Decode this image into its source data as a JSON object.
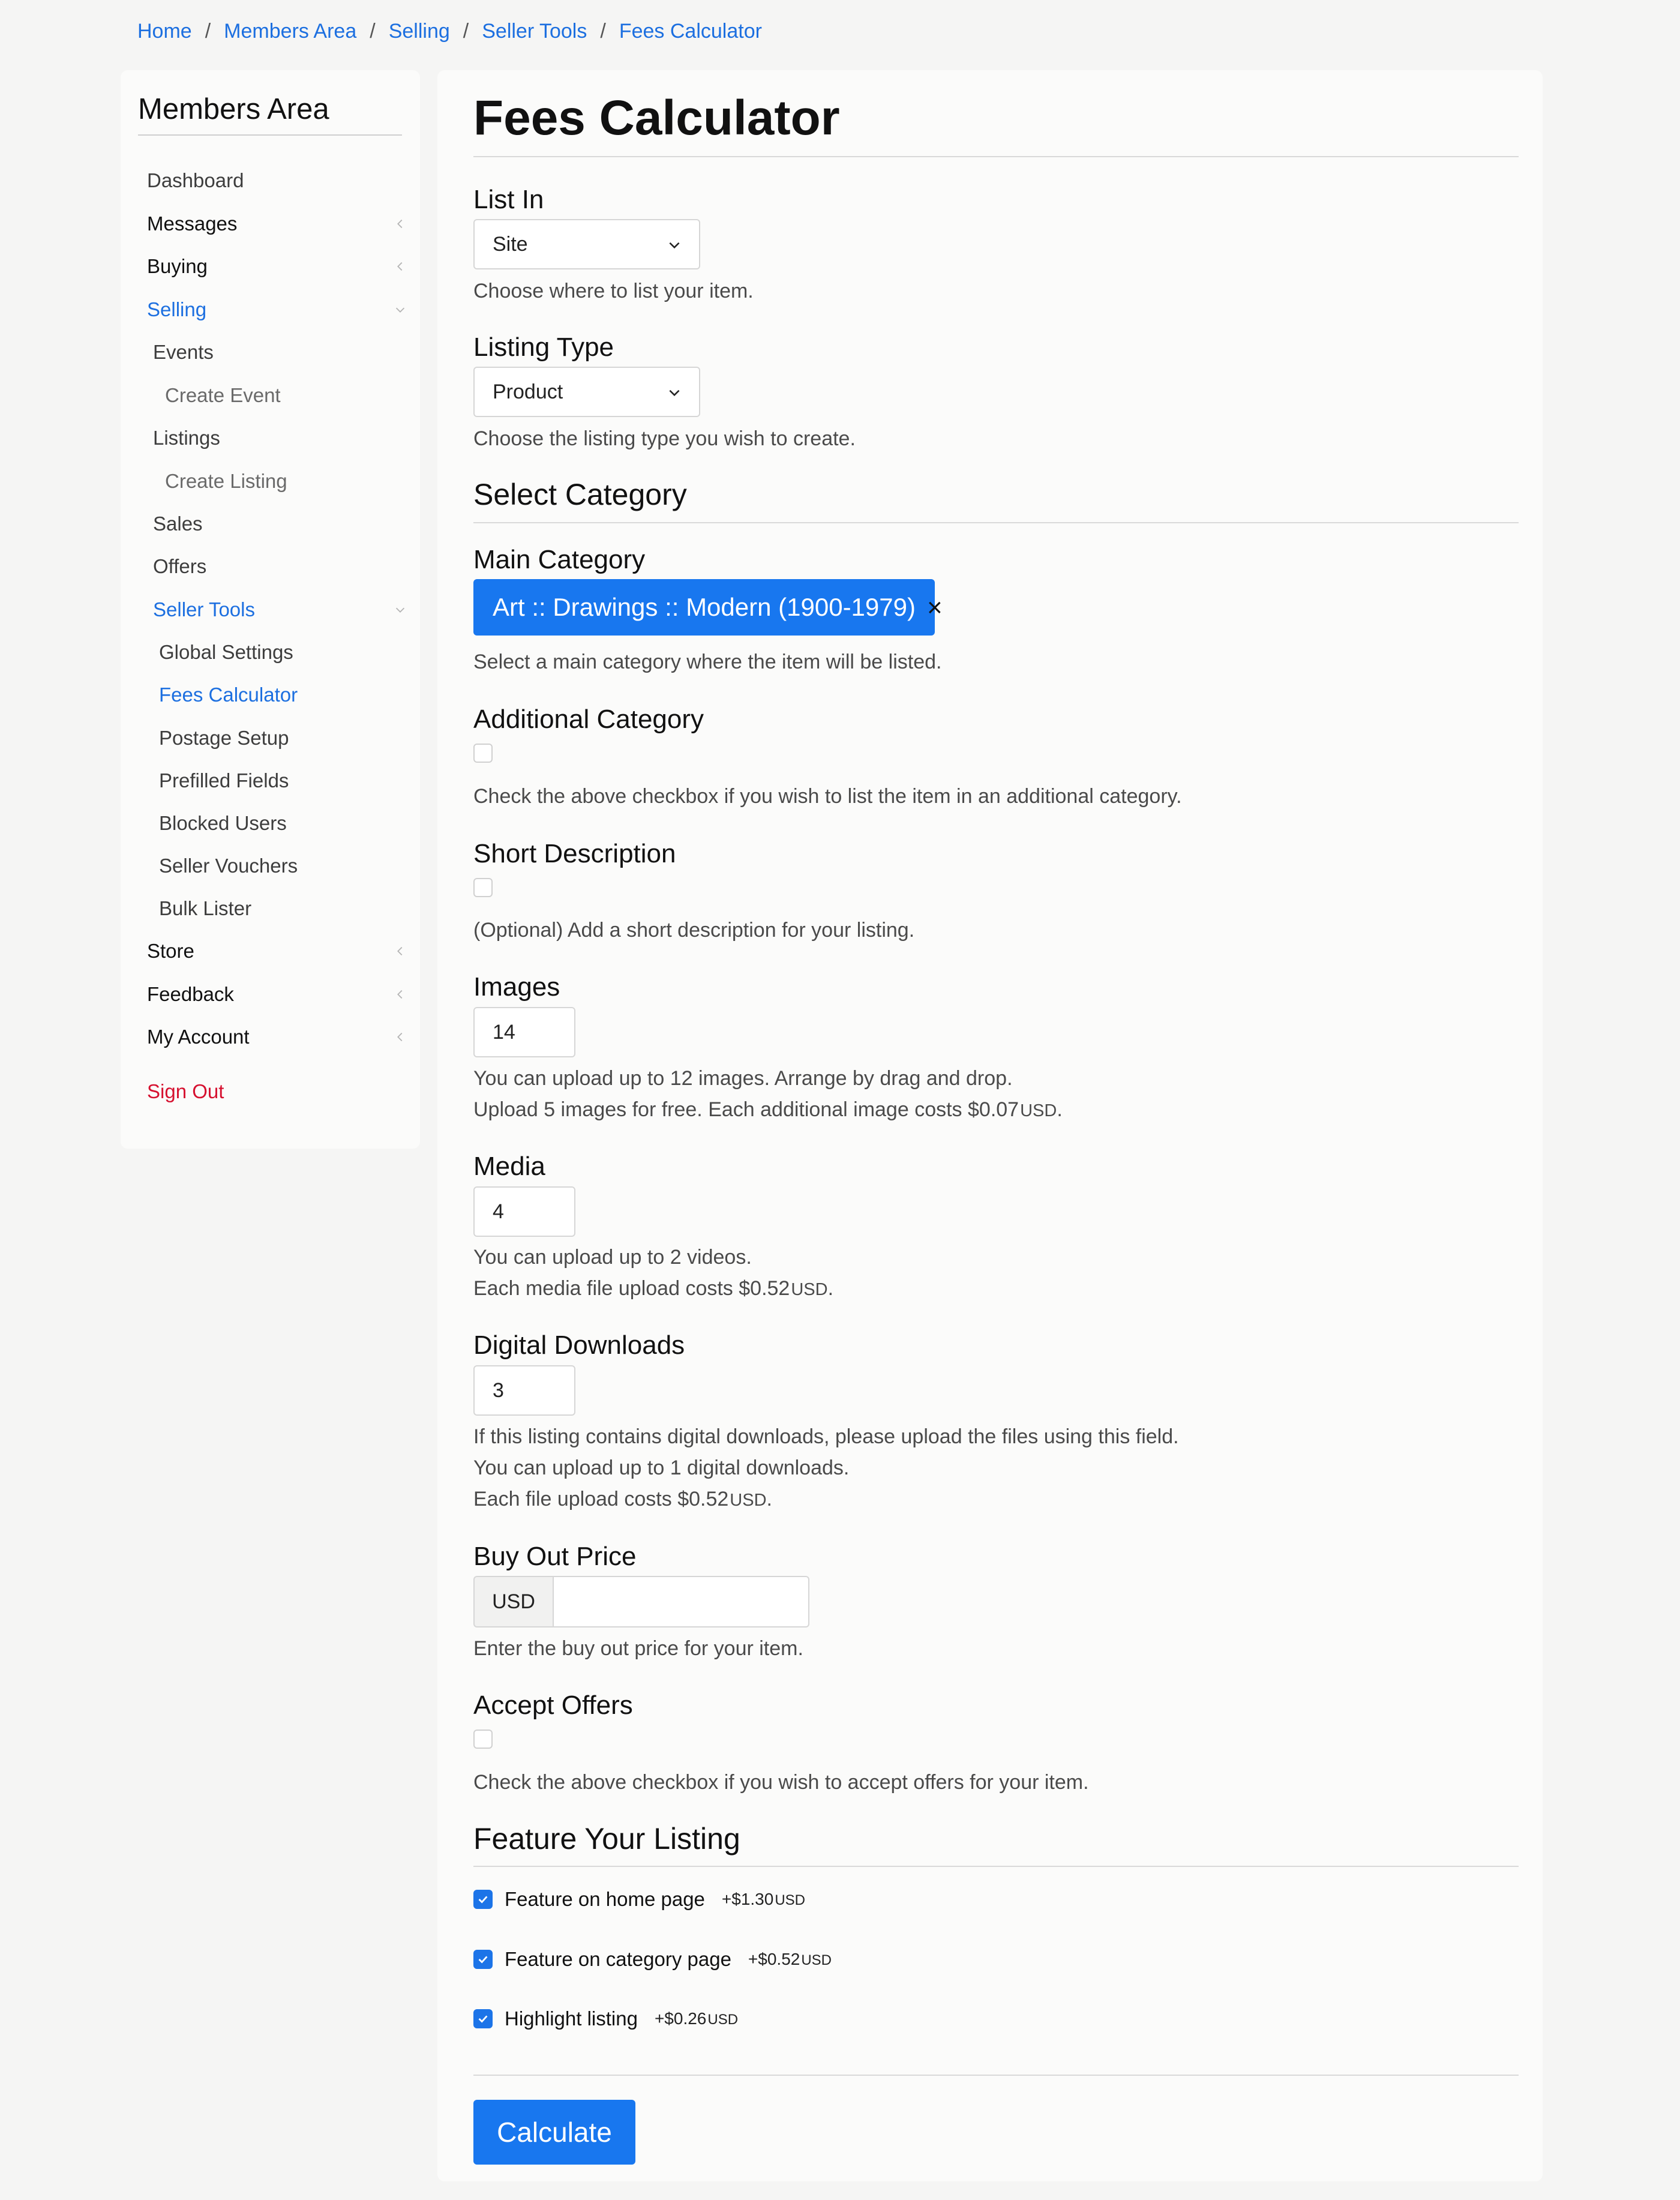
{
  "breadcrumb": [
    "Home",
    "Members Area",
    "Selling",
    "Seller Tools",
    "Fees Calculator"
  ],
  "breadcrumb_sep": "/",
  "sidebar": {
    "title": "Members Area",
    "items": {
      "dashboard": "Dashboard",
      "messages": "Messages",
      "buying": "Buying",
      "selling": "Selling",
      "events": "Events",
      "create_event": "Create Event",
      "listings": "Listings",
      "create_listing": "Create Listing",
      "sales": "Sales",
      "offers": "Offers",
      "seller_tools": "Seller Tools",
      "global_settings": "Global Settings",
      "fees_calculator": "Fees Calculator",
      "postage_setup": "Postage Setup",
      "prefilled_fields": "Prefilled Fields",
      "blocked_users": "Blocked Users",
      "seller_vouchers": "Seller Vouchers",
      "bulk_lister": "Bulk Lister",
      "store": "Store",
      "feedback": "Feedback",
      "my_account": "My Account",
      "sign_out": "Sign Out"
    }
  },
  "main": {
    "title": "Fees Calculator",
    "list_in": {
      "label": "List In",
      "value": "Site",
      "help": "Choose where to list your item."
    },
    "listing_type": {
      "label": "Listing Type",
      "value": "Product",
      "help": "Choose the listing type you wish to create."
    },
    "select_category": "Select Category",
    "main_category": {
      "label": "Main Category",
      "value": "Art :: Drawings :: Modern (1900-1979)",
      "remove": "×",
      "help": "Select a main category where the item will be listed."
    },
    "additional_category": {
      "label": "Additional Category",
      "checked": false,
      "help": "Check the above checkbox if you wish to list the item in an additional category."
    },
    "short_description": {
      "label": "Short Description",
      "checked": false,
      "help": "(Optional) Add a short description for your listing."
    },
    "images": {
      "label": "Images",
      "value": "14",
      "help1": "You can upload up to 12 images. Arrange by drag and drop.",
      "help2": "Upload 5 images for free. Each additional image costs $0.07",
      "currency": "USD",
      "suffix": "."
    },
    "media": {
      "label": "Media",
      "value": "4",
      "help1": "You can upload up to 2 videos.",
      "help2": "Each media file upload costs $0.52",
      "currency": "USD",
      "suffix": "."
    },
    "digital_downloads": {
      "label": "Digital Downloads",
      "value": "3",
      "help1": "If this listing contains digital downloads, please upload the files using this field.",
      "help2": "You can upload up to 1 digital downloads.",
      "help3": "Each file upload costs $0.52",
      "currency": "USD",
      "suffix": "."
    },
    "buy_out_price": {
      "label": "Buy Out Price",
      "addon": "USD",
      "value": "",
      "help": "Enter the buy out price for your item."
    },
    "accept_offers": {
      "label": "Accept Offers",
      "checked": false,
      "help": "Check the above checkbox if you wish to accept offers for your item."
    },
    "feature_section": "Feature Your Listing",
    "features": [
      {
        "label": "Feature on home page",
        "price": "+$1.30",
        "currency": "USD",
        "checked": true
      },
      {
        "label": "Feature on category page",
        "price": "+$0.52",
        "currency": "USD",
        "checked": true
      },
      {
        "label": "Highlight listing",
        "price": "+$0.26",
        "currency": "USD",
        "checked": true
      }
    ],
    "calculate_label": "Calculate"
  },
  "colors": {
    "accent": "#1877ef",
    "link": "#1c6fe0",
    "danger": "#d6102f",
    "background": "#f5f5f4",
    "panel": "#fbfbfa"
  }
}
